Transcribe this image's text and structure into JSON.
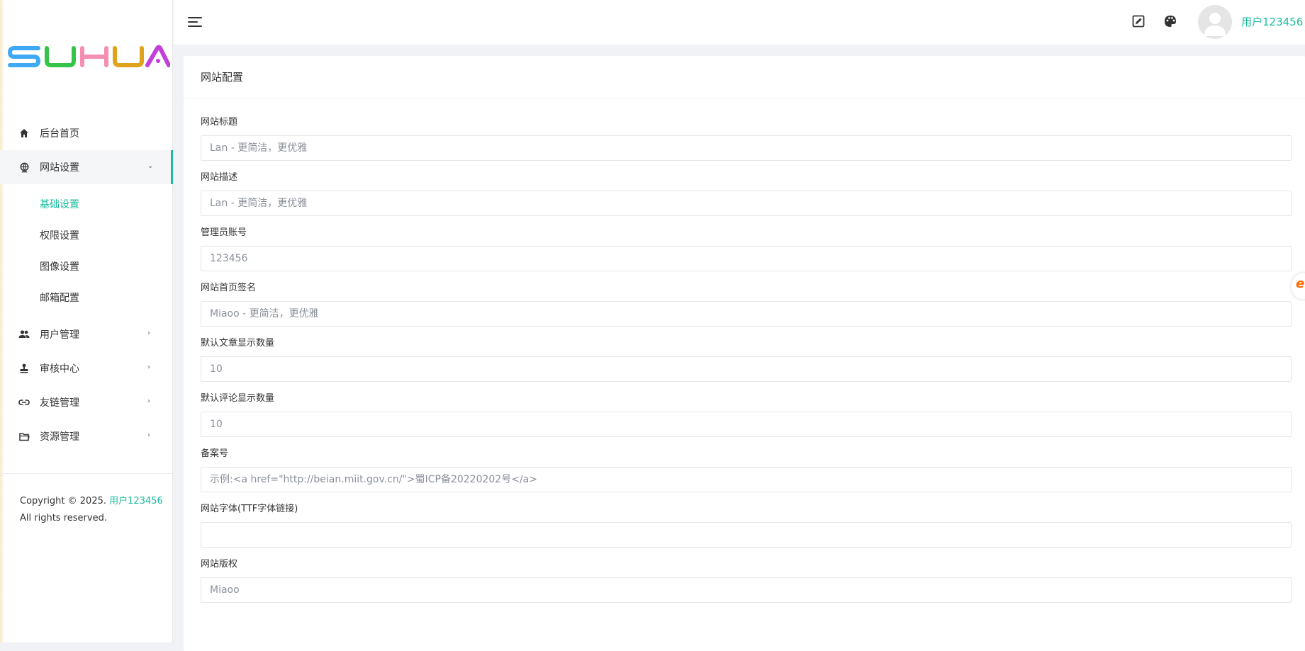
{
  "brand": {
    "logo_text": "SUHUA",
    "colors": [
      "#3fa9f5",
      "#35c44a",
      "#f48fb1",
      "#e0a21a",
      "#c23fd8"
    ]
  },
  "sidebar": {
    "items": [
      {
        "label": "后台首页",
        "icon": "home-icon"
      },
      {
        "label": "网站设置",
        "icon": "globe-icon",
        "expanded": true,
        "children": [
          {
            "label": "基础设置",
            "active": true
          },
          {
            "label": "权限设置"
          },
          {
            "label": "图像设置"
          },
          {
            "label": "邮箱配置"
          }
        ]
      },
      {
        "label": "用户管理",
        "icon": "users-icon"
      },
      {
        "label": "审核中心",
        "icon": "stamp-icon"
      },
      {
        "label": "友链管理",
        "icon": "link-icon"
      },
      {
        "label": "资源管理",
        "icon": "folder-icon"
      }
    ],
    "copyright": {
      "prefix": "Copyright © 2025.",
      "user": "用户123456",
      "suffix": "All rights reserved."
    }
  },
  "header": {
    "user_name": "用户123456"
  },
  "main": {
    "title": "网站配置",
    "fields": [
      {
        "label": "网站标题",
        "placeholder": "Lan - 更简洁，更优雅",
        "value": ""
      },
      {
        "label": "网站描述",
        "placeholder": "Lan - 更简洁，更优雅",
        "value": ""
      },
      {
        "label": "管理员账号",
        "placeholder": "123456",
        "value": ""
      },
      {
        "label": "网站首页签名",
        "placeholder": "Miaoo - 更简洁，更优雅",
        "value": ""
      },
      {
        "label": "默认文章显示数量",
        "placeholder": "10",
        "value": ""
      },
      {
        "label": "默认评论显示数量",
        "placeholder": "10",
        "value": ""
      },
      {
        "label": "备案号",
        "placeholder": "示例:<a href=\"http://beian.miit.gov.cn/\">蜀ICP备20220202号</a>",
        "value": ""
      },
      {
        "label": "网站字体(TTF字体链接)",
        "placeholder": "",
        "value": ""
      },
      {
        "label": "网站版权",
        "placeholder": "Miaoo",
        "value": ""
      }
    ]
  },
  "accent_color": "#1abc9c"
}
